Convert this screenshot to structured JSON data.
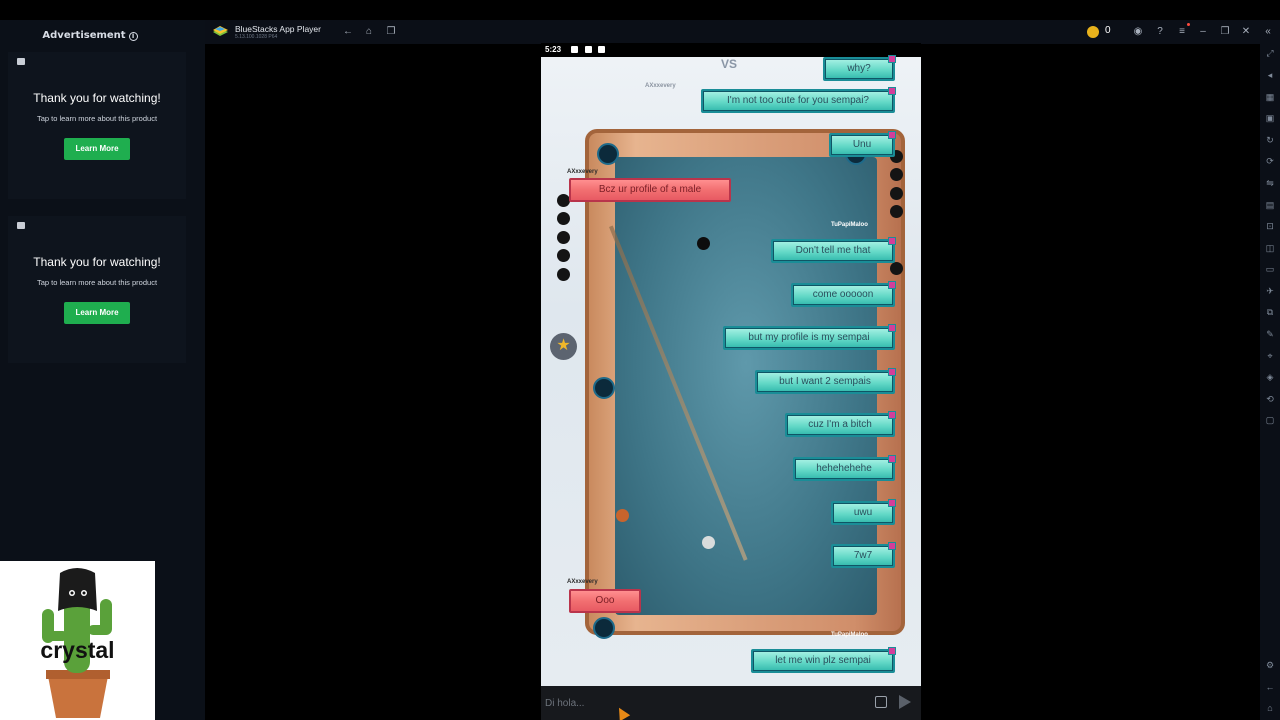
{
  "ads": {
    "heading": "Advertisement",
    "cards": [
      {
        "title": "Thank you for watching!",
        "subtitle": "Tap to learn more about this product",
        "button": "Learn More"
      },
      {
        "title": "Thank you for watching!",
        "subtitle": "Tap to learn more about this product",
        "button": "Learn More"
      }
    ],
    "cactus_label": "crystal"
  },
  "bluestacks": {
    "title": "BlueStacks App Player",
    "version": "5.13.100.1028 P64",
    "coins": "0",
    "toolbar_icons": [
      "back-icon",
      "home-icon",
      "multi-instance-icon",
      "coin-icon",
      "account-icon",
      "help-icon",
      "menu-icon",
      "minimize-icon",
      "restore-icon",
      "close-icon",
      "collapse-icon"
    ],
    "sidebar_icons": [
      "fullscreen-icon",
      "volume-icon",
      "keyboard-icon",
      "gamepad-icon",
      "rotate-icon",
      "refresh-icon",
      "shake-icon",
      "macro-icon",
      "screenshot-icon",
      "record-icon",
      "media-icon",
      "airplane-icon",
      "copy-icon",
      "eco-icon",
      "location-icon",
      "layers-icon",
      "sync-icon",
      "settings-icon",
      "back-icon",
      "home-icon",
      "recents-icon"
    ]
  },
  "phone": {
    "time": "5:23",
    "vs_text": "VS",
    "opponent_name": "AXxxevery",
    "player_name": "TuPapiMaloo",
    "right_messages": [
      {
        "text": "why?"
      },
      {
        "text": "I'm not too cute for you sempai?"
      },
      {
        "text": "Unu"
      },
      {
        "text": "Don't tell me that"
      },
      {
        "text": "come ooooon"
      },
      {
        "text": "but my profile is my sempai"
      },
      {
        "text": "but I want 2 sempais"
      },
      {
        "text": "cuz I'm a bitch"
      },
      {
        "text": "hehehehehe"
      },
      {
        "text": "uwu"
      },
      {
        "text": "7w7"
      },
      {
        "text": "let me win plz sempai"
      }
    ],
    "left_messages": [
      {
        "text": "Bcz ur profile of a male"
      },
      {
        "text": "Ooo"
      }
    ],
    "chat_placeholder": "Di hola..."
  },
  "colors": {
    "ad_button": "#1fae4f",
    "bubble_teal": "#64d9c7",
    "bubble_pink": "#f26f71",
    "coin": "#e8b21c"
  }
}
